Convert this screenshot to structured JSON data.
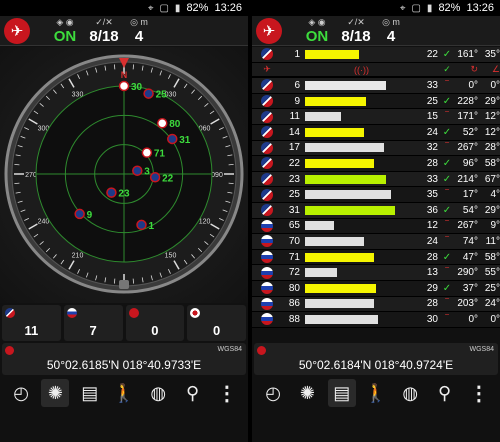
{
  "status": {
    "battery": "82%",
    "time": "13:26"
  },
  "header": {
    "fix_status": "ON",
    "sats_used_visible": "8/18",
    "accuracy": "4"
  },
  "compass": {
    "north_label": "N",
    "satellites": [
      {
        "prn": "30",
        "flag": "ru",
        "azimuth": 0,
        "elevation": 0
      },
      {
        "prn": "25",
        "flag": "us",
        "azimuth": 17,
        "elevation": 4
      },
      {
        "prn": "80",
        "flag": "ru",
        "azimuth": 37,
        "elevation": 25
      },
      {
        "prn": "31",
        "flag": "us",
        "azimuth": 54,
        "elevation": 29
      },
      {
        "prn": "71",
        "flag": "ru",
        "azimuth": 47,
        "elevation": 58
      },
      {
        "prn": "3",
        "flag": "us",
        "azimuth": 76,
        "elevation": 76
      },
      {
        "prn": "22",
        "flag": "us",
        "azimuth": 96,
        "elevation": 58
      },
      {
        "prn": "23",
        "flag": "us",
        "azimuth": 214,
        "elevation": 67
      },
      {
        "prn": "9",
        "flag": "us",
        "azimuth": 228,
        "elevation": 29
      },
      {
        "prn": "1",
        "flag": "us",
        "azimuth": 161,
        "elevation": 35
      }
    ]
  },
  "sat_counts": {
    "us": "11",
    "ru": "7",
    "cn": "0",
    "jp": "0"
  },
  "left_coords": {
    "datum": "WGS84",
    "text": "50°02.6185'N  018°40.9733'E"
  },
  "right_coords": {
    "datum": "WGS84",
    "text": "50°02.6184'N  018°40.9724'E"
  },
  "table": {
    "rows": [
      {
        "flag": "us",
        "prn": "1",
        "snr": "22",
        "used": true,
        "az": "161°",
        "el": "35°",
        "bar": 0.48,
        "color": "#f5f500"
      },
      {
        "flag": "us",
        "prn": "3",
        "snr": "36",
        "used": true,
        "az": "76°",
        "el": "76°",
        "bar": 0.8,
        "color": "#b8f000"
      },
      {
        "flag": "us",
        "prn": "6",
        "snr": "33",
        "used": false,
        "az": "0°",
        "el": "0°",
        "bar": 0.72,
        "color": "#e8e8e8"
      },
      {
        "flag": "us",
        "prn": "9",
        "snr": "25",
        "used": true,
        "az": "228°",
        "el": "29°",
        "bar": 0.54,
        "color": "#f5f500"
      },
      {
        "flag": "us",
        "prn": "11",
        "snr": "15",
        "used": false,
        "az": "171°",
        "el": "12°",
        "bar": 0.32,
        "color": "#e0e0e0"
      },
      {
        "flag": "us",
        "prn": "14",
        "snr": "24",
        "used": true,
        "az": "52°",
        "el": "12°",
        "bar": 0.52,
        "color": "#f5f500"
      },
      {
        "flag": "us",
        "prn": "17",
        "snr": "32",
        "used": false,
        "az": "267°",
        "el": "28°",
        "bar": 0.7,
        "color": "#e0e0e0"
      },
      {
        "flag": "us",
        "prn": "22",
        "snr": "28",
        "used": true,
        "az": "96°",
        "el": "58°",
        "bar": 0.61,
        "color": "#f5f500"
      },
      {
        "flag": "us",
        "prn": "23",
        "snr": "33",
        "used": true,
        "az": "214°",
        "el": "67°",
        "bar": 0.72,
        "color": "#b8f000"
      },
      {
        "flag": "us",
        "prn": "25",
        "snr": "35",
        "used": false,
        "az": "17°",
        "el": "4°",
        "bar": 0.76,
        "color": "#e0e0e0"
      },
      {
        "flag": "us",
        "prn": "31",
        "snr": "36",
        "used": true,
        "az": "54°",
        "el": "29°",
        "bar": 0.8,
        "color": "#b8f000"
      },
      {
        "flag": "ru",
        "prn": "65",
        "snr": "12",
        "used": false,
        "az": "267°",
        "el": "9°",
        "bar": 0.26,
        "color": "#e0e0e0"
      },
      {
        "flag": "ru",
        "prn": "70",
        "snr": "24",
        "used": false,
        "az": "74°",
        "el": "11°",
        "bar": 0.52,
        "color": "#e0e0e0"
      },
      {
        "flag": "ru",
        "prn": "71",
        "snr": "28",
        "used": true,
        "az": "47°",
        "el": "58°",
        "bar": 0.61,
        "color": "#f5f500"
      },
      {
        "flag": "ru",
        "prn": "72",
        "snr": "13",
        "used": false,
        "az": "290°",
        "el": "55°",
        "bar": 0.28,
        "color": "#e0e0e0"
      },
      {
        "flag": "ru",
        "prn": "80",
        "snr": "29",
        "used": true,
        "az": "37°",
        "el": "25°",
        "bar": 0.63,
        "color": "#f5f500"
      },
      {
        "flag": "ru",
        "prn": "86",
        "snr": "28",
        "used": false,
        "az": "203°",
        "el": "24°",
        "bar": 0.61,
        "color": "#e0e0e0"
      },
      {
        "flag": "ru",
        "prn": "88",
        "snr": "30",
        "used": false,
        "az": "0°",
        "el": "0°",
        "bar": 0.65,
        "color": "#e0e0e0"
      }
    ]
  },
  "nav": [
    "compass-icon",
    "skyview-icon",
    "signal-bars-icon",
    "walk-icon",
    "globe-icon",
    "location-pin-icon",
    "more-icon"
  ]
}
